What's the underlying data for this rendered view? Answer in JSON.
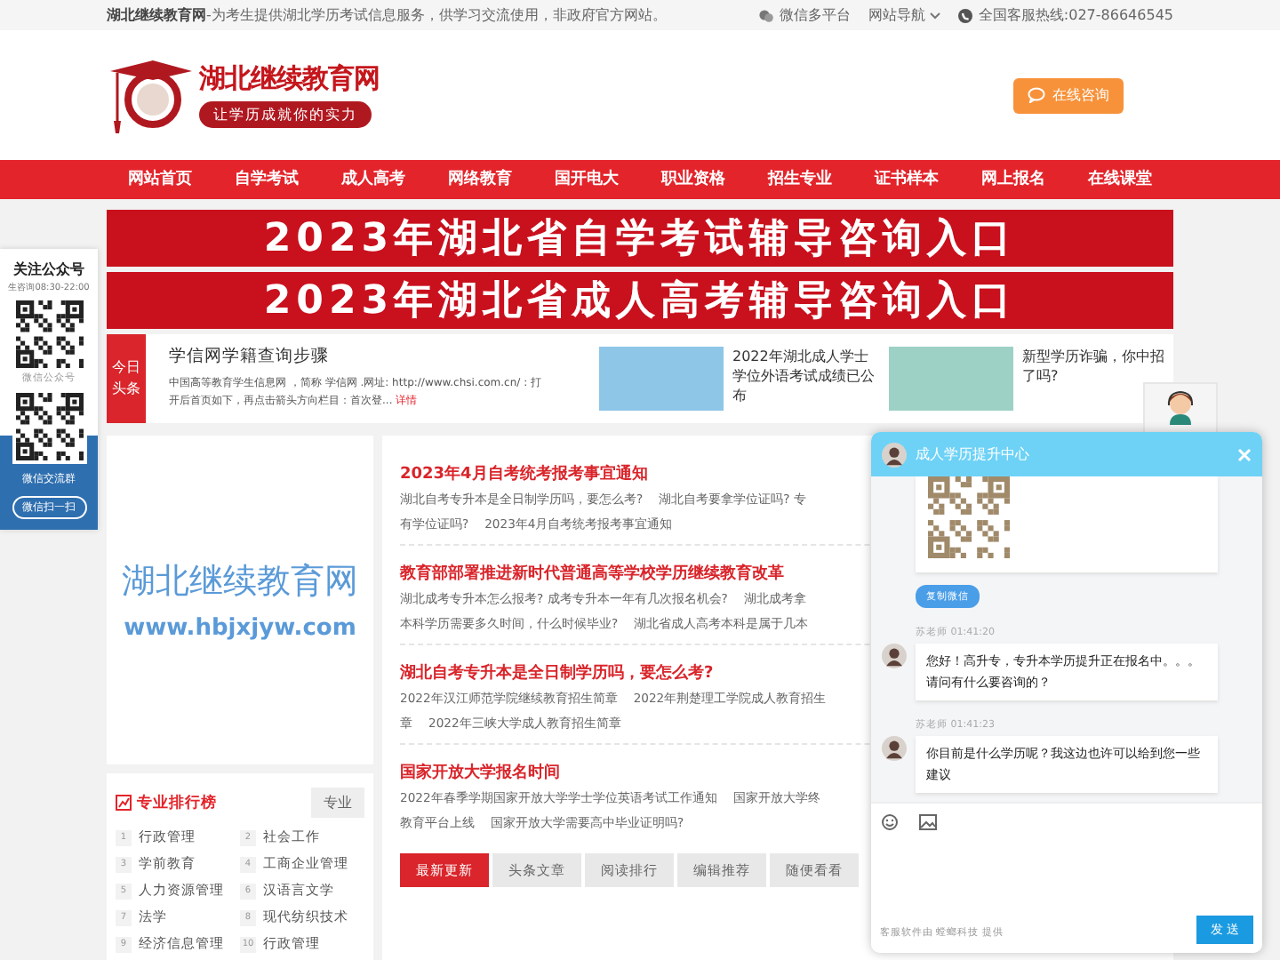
{
  "top_bar": {
    "site_name": "湖北继续教育网",
    "tagline": "-为考生提供湖北学历考试信息服务，供学习交流使用，非政府官方网站。",
    "links": [
      {
        "kind": "wechat",
        "label": "微信多平台"
      },
      {
        "kind": "menu",
        "label": "网站导航"
      },
      {
        "kind": "phone",
        "label": "全国客服热线:027-86646545"
      }
    ]
  },
  "header": {
    "logo_title": "湖北继续教育网",
    "logo_slogan": "让学历成就你的实力",
    "consult_button": "在线咨询"
  },
  "nav": [
    "网站首页",
    "自学考试",
    "成人高考",
    "网络教育",
    "国开电大",
    "职业资格",
    "招生专业",
    "证书样本",
    "网上报名",
    "在线课堂"
  ],
  "follow_panel": {
    "title": "关注公众号",
    "hours": "生咨询08:30-22:00",
    "qr_caption": "微信公众号",
    "group_caption": "微信交流群",
    "scan_button": "微信扫一扫"
  },
  "banners": [
    "2023年湖北省自学考试辅导咨询入口",
    "2023年湖北省成人高考辅导咨询入口"
  ],
  "headline": {
    "badge": "今日头条",
    "title": "学信网学籍查询步骤",
    "summary": "中国高等教育学生信息网 ，简称 学信网 .网址: http://www.chsi.com.cn/ : 打开后首页如下，再点击箭头方向栏目：首次登...",
    "more": "详情"
  },
  "featured": [
    {
      "caption": "2022年湖北成人学士学位外语考试成绩已公布"
    },
    {
      "caption": "新型学历诈骗，你中招了吗?"
    }
  ],
  "promo": {
    "title": "湖北继续教育网",
    "url": "www.hbjxjyw.com"
  },
  "ranking": {
    "title": "专业排行榜",
    "tag": "专业",
    "items": [
      {
        "rank": "1",
        "name": "行政管理"
      },
      {
        "rank": "2",
        "name": "社会工作"
      },
      {
        "rank": "3",
        "name": "学前教育"
      },
      {
        "rank": "4",
        "name": "工商企业管理"
      },
      {
        "rank": "5",
        "name": "人力资源管理"
      },
      {
        "rank": "6",
        "name": "汉语言文学"
      },
      {
        "rank": "7",
        "name": "法学"
      },
      {
        "rank": "8",
        "name": "现代纺织技术"
      },
      {
        "rank": "9",
        "name": "经济信息管理"
      },
      {
        "rank": "10",
        "name": "行政管理"
      }
    ]
  },
  "news": [
    {
      "title": "2023年4月自考统考报考事宜通知",
      "lines": [
        [
          "湖北自考专升本是全日制学历吗，要怎么考?",
          "湖北自考要拿学位证吗? 专"
        ],
        [
          "有学位证吗?",
          "2023年4月自考统考报考事宜通知"
        ]
      ]
    },
    {
      "title": "教育部部署推进新时代普通高等学校学历继续教育改革",
      "lines": [
        [
          "湖北成考专升本怎么报考? 成考专升本一年有几次报名机会?",
          "湖北成考拿"
        ],
        [
          "本科学历需要多久时间，什么时候毕业?",
          "湖北省成人高考本科是属于几本"
        ]
      ]
    },
    {
      "title": "湖北自考专升本是全日制学历吗，要怎么考?",
      "lines": [
        [
          "2022年汉江师范学院继续教育招生简章",
          "2022年荆楚理工学院成人教育招生"
        ],
        [
          "章",
          "2022年三峡大学成人教育招生简章"
        ]
      ]
    },
    {
      "title": "国家开放大学报名时间",
      "lines": [
        [
          "2022年春季学期国家开放大学学士学位英语考试工作通知",
          "国家开放大学终"
        ],
        [
          "教育平台上线",
          "国家开放大学需要高中毕业证明吗?"
        ]
      ]
    }
  ],
  "tabs": [
    {
      "label": "最新更新",
      "selected": true
    },
    {
      "label": "头条文章",
      "selected": false
    },
    {
      "label": "阅读排行",
      "selected": false
    },
    {
      "label": "编辑推荐",
      "selected": false
    },
    {
      "label": "随便看看",
      "selected": false
    }
  ],
  "chat": {
    "title": "成人学历提升中心",
    "copy_button": "复制微信",
    "messages": [
      {
        "meta": "苏老师 01:41:20",
        "text": "您好！高升专，专升本学历提升正在报名中。。。请问有什么要咨询的？"
      },
      {
        "meta": "苏老师 01:41:23",
        "text": "你目前是什么学历呢？我这边也许可以给到您一些建议"
      }
    ],
    "footer": "客服软件由 螳螂科技 提供",
    "send_button": "发 送"
  }
}
